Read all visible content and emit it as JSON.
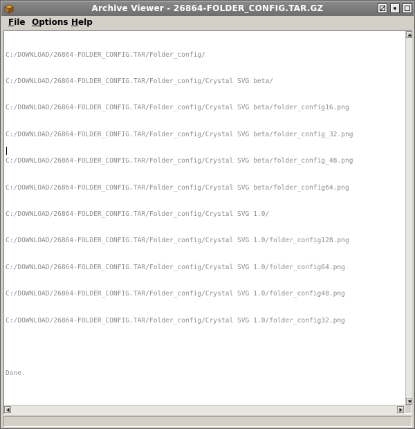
{
  "window": {
    "title": "Archive Viewer - 26864-FOLDER_CONFIG.TAR.GZ",
    "icons": {
      "app": "archive-box-icon",
      "maximize": "maximize-icon",
      "minimize": "minimize-icon",
      "close": "close-icon"
    }
  },
  "menu": {
    "file": {
      "mnemonic": "F",
      "rest": "ile"
    },
    "options": {
      "mnemonic": "O",
      "rest": "ptions"
    },
    "help": {
      "mnemonic": "H",
      "rest": "elp"
    }
  },
  "output": {
    "lines": [
      "C:/DOWNLOAD/26864-FOLDER_CONFIG.TAR/Folder_config/",
      "C:/DOWNLOAD/26864-FOLDER_CONFIG.TAR/Folder_config/Crystal SVG beta/",
      "C:/DOWNLOAD/26864-FOLDER_CONFIG.TAR/Folder_config/Crystal SVG beta/folder_config16.png",
      "C:/DOWNLOAD/26864-FOLDER_CONFIG.TAR/Folder_config/Crystal SVG beta/folder_config_32.png",
      "C:/DOWNLOAD/26864-FOLDER_CONFIG.TAR/Folder_config/Crystal SVG beta/folder_config_48.png",
      "C:/DOWNLOAD/26864-FOLDER_CONFIG.TAR/Folder_config/Crystal SVG beta/folder_config64.png",
      "C:/DOWNLOAD/26864-FOLDER_CONFIG.TAR/Folder_config/Crystal SVG 1.0/",
      "C:/DOWNLOAD/26864-FOLDER_CONFIG.TAR/Folder_config/Crystal SVG 1.0/folder_config128.png",
      "C:/DOWNLOAD/26864-FOLDER_CONFIG.TAR/Folder_config/Crystal SVG 1.0/folder_config64.png",
      "C:/DOWNLOAD/26864-FOLDER_CONFIG.TAR/Folder_config/Crystal SVG 1.0/folder_config48.png",
      "C:/DOWNLOAD/26864-FOLDER_CONFIG.TAR/Folder_config/Crystal SVG 1.0/folder_config32.png",
      "",
      "Done."
    ],
    "text_color": "#8c8c8c"
  },
  "scrollbars": {
    "icons": {
      "up": "arrow-up-icon",
      "down": "arrow-down-icon",
      "left": "arrow-left-icon",
      "right": "arrow-right-icon"
    }
  },
  "status": {
    "text": ""
  }
}
